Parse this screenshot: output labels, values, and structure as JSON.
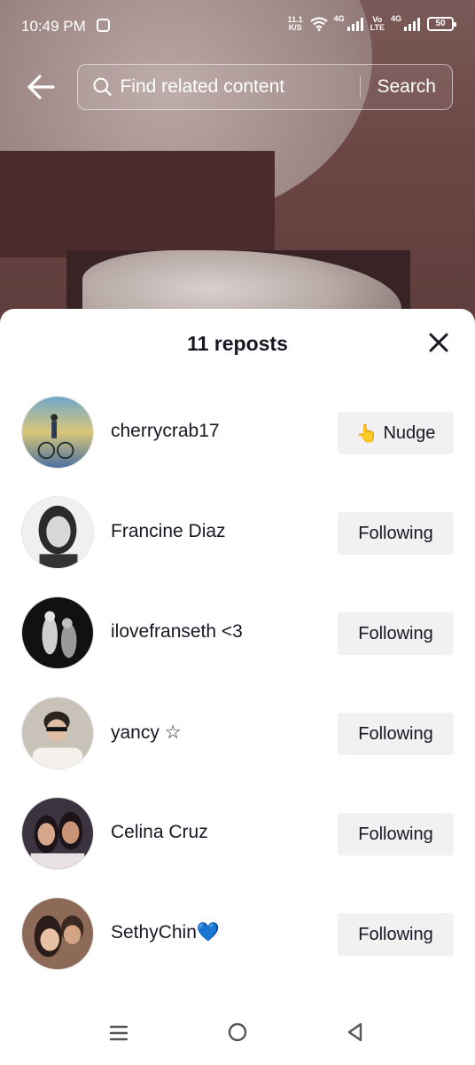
{
  "status_bar": {
    "time": "10:49 PM",
    "net_speed_value": "11.1",
    "net_speed_unit": "K/S",
    "signal1_label": "4G",
    "volte_label_top": "Vo",
    "volte_label_bottom": "LTE",
    "signal2_label": "4G",
    "battery": "50"
  },
  "search": {
    "placeholder": "Find related content",
    "button_label": "Search"
  },
  "sheet": {
    "title": "11 reposts",
    "users": [
      {
        "name": "cherrycrab17",
        "action": "Nudge",
        "action_emoji": "👆"
      },
      {
        "name": "Francine Diaz",
        "action": "Following"
      },
      {
        "name": "ilovefranseth <3",
        "action": "Following"
      },
      {
        "name": "yancy ☆",
        "action": "Following"
      },
      {
        "name": "Celina Cruz",
        "action": "Following"
      },
      {
        "name": "SethyChin💙",
        "action": "Following"
      }
    ]
  },
  "colors": {
    "sheet_bg": "#ffffff",
    "button_bg": "#f1f1f2",
    "text": "#161823"
  }
}
